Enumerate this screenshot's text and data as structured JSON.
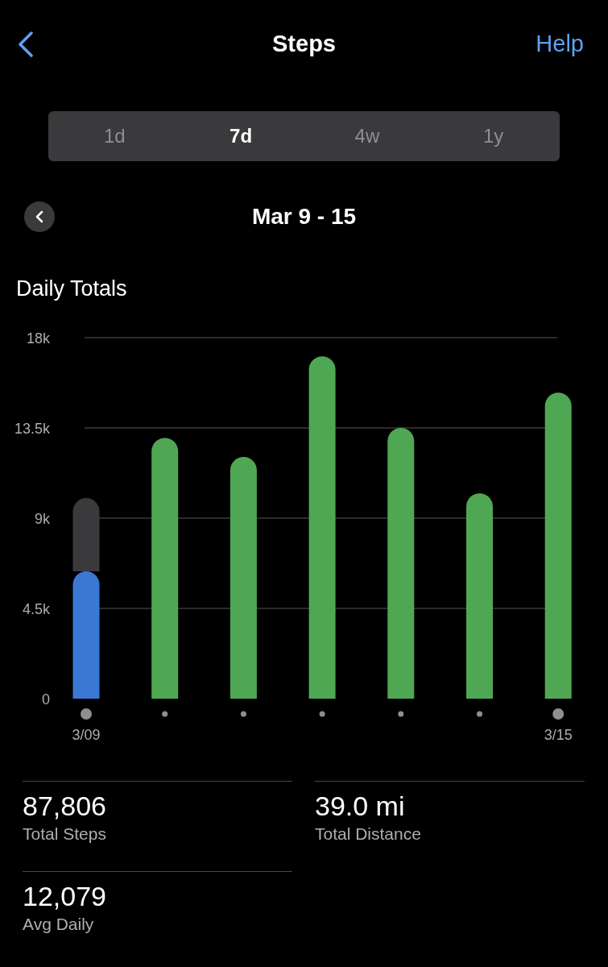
{
  "header": {
    "title": "Steps",
    "action": "Help"
  },
  "periods": [
    {
      "label": "1d",
      "selected": false
    },
    {
      "label": "7d",
      "selected": true
    },
    {
      "label": "4w",
      "selected": false
    },
    {
      "label": "1y",
      "selected": false
    }
  ],
  "date_range": "Mar 9 - 15",
  "section_title": "Daily Totals",
  "chart_data": {
    "type": "bar",
    "stacked": true,
    "grid": true,
    "categories": [
      "3/09",
      null,
      null,
      null,
      null,
      null,
      "3/15"
    ],
    "ylim": [
      0,
      18000
    ],
    "yticks": [
      {
        "value": 0,
        "label": "0"
      },
      {
        "value": 4500,
        "label": "4.5k"
      },
      {
        "value": 9000,
        "label": "9k"
      },
      {
        "value": 13500,
        "label": "13.5k"
      },
      {
        "value": 18000,
        "label": "18k"
      }
    ],
    "series": [
      {
        "color": "#3a78d4",
        "values": [
          6350,
          null,
          null,
          null,
          null,
          null,
          null
        ]
      },
      {
        "color": "#50a753",
        "values": [
          null,
          13000,
          12050,
          17070,
          13500,
          10240,
          15260
        ]
      },
      {
        "color": "#3a3a3c",
        "values": [
          3650,
          null,
          null,
          null,
          null,
          null,
          null
        ]
      }
    ]
  },
  "stats": [
    {
      "value": "87,806",
      "label": "Total Steps"
    },
    {
      "value": "39.0 mi",
      "label": "Total Distance"
    },
    {
      "value": "12,079",
      "label": "Avg Daily"
    }
  ]
}
